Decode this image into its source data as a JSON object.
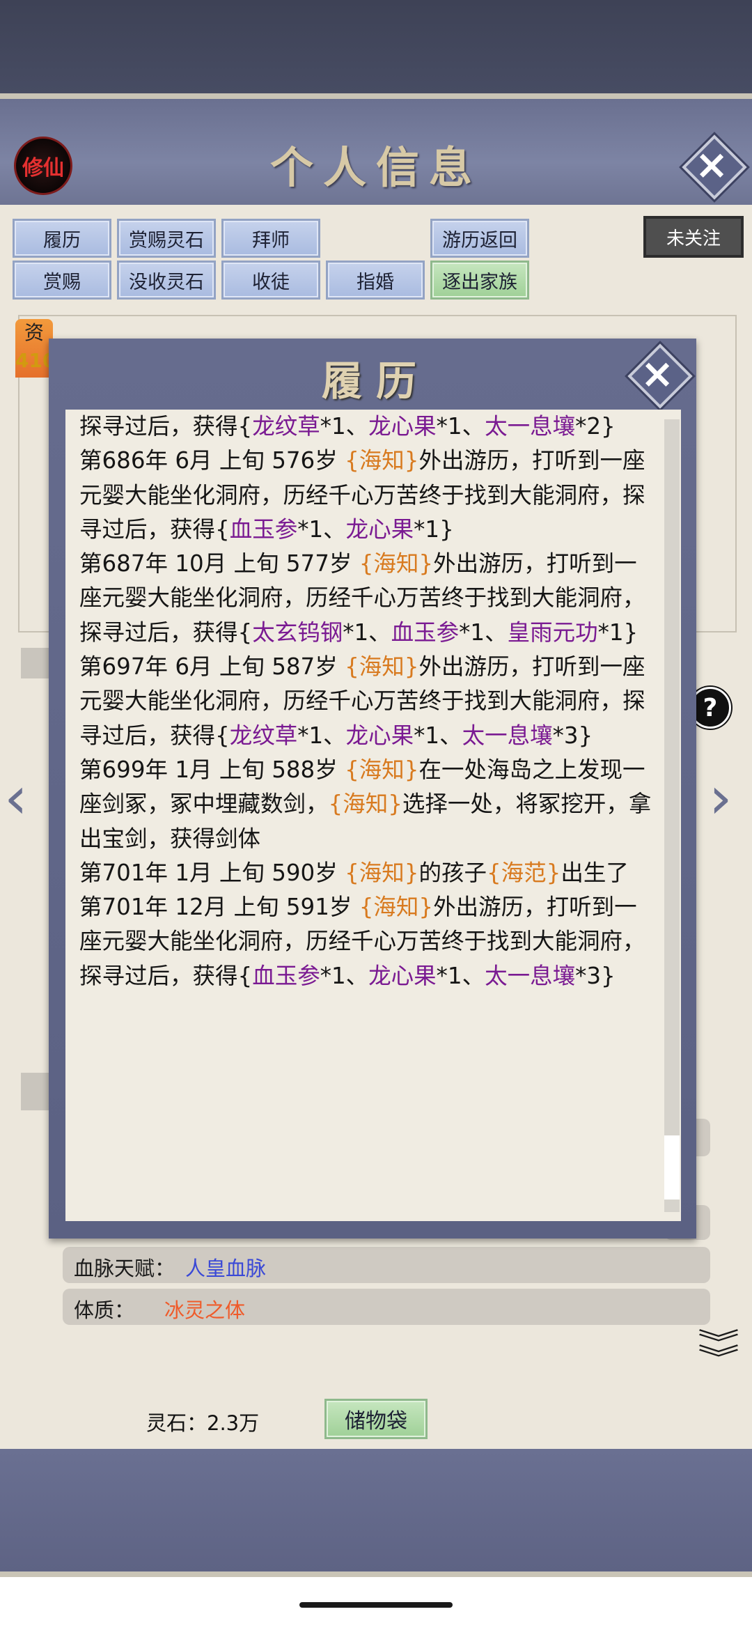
{
  "header": {
    "title": "个人信息",
    "badge": "修仙"
  },
  "buttons": {
    "row1": [
      "履历",
      "赏赐灵石",
      "拜师",
      "游历返回"
    ],
    "row2": [
      "赏赐",
      "没收灵石",
      "收徒",
      "指婚",
      "逐出家族"
    ],
    "follow": "未关注"
  },
  "profile": {
    "stat_label": "资",
    "stat_value": "410",
    "bloodline_label": "血脉天赋：",
    "bloodline_value": "人皇血脉",
    "physique_label": "体质：",
    "physique_value": "冰灵之体"
  },
  "bottom": {
    "stones": "灵石：2.3万",
    "bag_button": "储物袋"
  },
  "modal": {
    "title": "履历",
    "entries": [
      [
        [
          "t",
          "探寻过后，获得{"
        ],
        [
          "p",
          "龙纹草"
        ],
        [
          "t",
          "*1、"
        ],
        [
          "p",
          "龙心果"
        ],
        [
          "t",
          "*1、"
        ],
        [
          "p",
          "太一息壤"
        ],
        [
          "t",
          "*2}"
        ]
      ],
      [
        [
          "t",
          "第686年 6月 上旬 576岁 "
        ],
        [
          "y",
          "{海知}"
        ],
        [
          "t",
          "外出游历，打听到一座元婴大能坐化洞府，历经千心万苦终于找到大能洞府，探寻过后，获得{"
        ],
        [
          "p",
          "血玉参"
        ],
        [
          "t",
          "*1、"
        ],
        [
          "p",
          "龙心果"
        ],
        [
          "t",
          "*1}"
        ]
      ],
      [
        [
          "t",
          "第687年 10月 上旬 577岁 "
        ],
        [
          "y",
          "{海知}"
        ],
        [
          "t",
          "外出游历，打听到一座元婴大能坐化洞府，历经千心万苦终于找到大能洞府，探寻过后，获得{"
        ],
        [
          "p",
          "太玄钨钢"
        ],
        [
          "t",
          "*1、"
        ],
        [
          "p",
          "血玉参"
        ],
        [
          "t",
          "*1、"
        ],
        [
          "p",
          "皇雨元功"
        ],
        [
          "t",
          "*1}"
        ]
      ],
      [
        [
          "t",
          "第697年 6月 上旬 587岁 "
        ],
        [
          "y",
          "{海知}"
        ],
        [
          "t",
          "外出游历，打听到一座元婴大能坐化洞府，历经千心万苦终于找到大能洞府，探寻过后，获得{"
        ],
        [
          "p",
          "龙纹草"
        ],
        [
          "t",
          "*1、"
        ],
        [
          "p",
          "龙心果"
        ],
        [
          "t",
          "*1、"
        ],
        [
          "p",
          "太一息壤"
        ],
        [
          "t",
          "*3}"
        ]
      ],
      [
        [
          "t",
          "第699年 1月 上旬 588岁 "
        ],
        [
          "y",
          "{海知}"
        ],
        [
          "t",
          "在一处海岛之上发现一座剑冢，冢中埋藏数剑，"
        ],
        [
          "y",
          "{海知}"
        ],
        [
          "t",
          "选择一处，将冢挖开，拿出宝剑，获得剑体"
        ]
      ],
      [
        [
          "t",
          "第701年 1月 上旬  590岁 "
        ],
        [
          "y",
          "{海知}"
        ],
        [
          "t",
          "的孩子"
        ],
        [
          "y",
          "{海范}"
        ],
        [
          "t",
          "出生了"
        ]
      ],
      [
        [
          "t",
          "第701年 12月 上旬 591岁 "
        ],
        [
          "y",
          "{海知}"
        ],
        [
          "t",
          "外出游历，打听到一座元婴大能坐化洞府，历经千心万苦终于找到大能洞府，探寻过后，获得{"
        ],
        [
          "p",
          "血玉参"
        ],
        [
          "t",
          "*1、"
        ],
        [
          "p",
          "龙心果"
        ],
        [
          "t",
          "*1、"
        ],
        [
          "p",
          "太一息壤"
        ],
        [
          "t",
          "*3}"
        ]
      ]
    ]
  },
  "colors": {
    "highlight_name": "#d87a1f",
    "highlight_item": "#7a1a92",
    "bloodline": "#3a49d6",
    "physique": "#ef5b2a"
  }
}
